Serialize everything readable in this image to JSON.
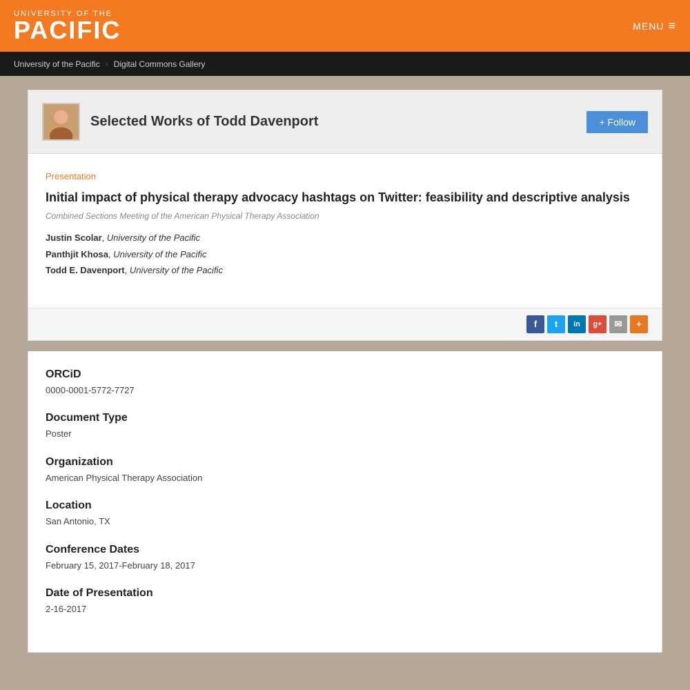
{
  "header": {
    "logo_top": "UNIVERSITY OF THE",
    "logo_bottom": "PACIFIC",
    "menu_label": "MENU"
  },
  "nav": {
    "links": [
      {
        "label": "University of the Pacific"
      },
      {
        "label": "Digital Commons Gallery"
      }
    ]
  },
  "profile": {
    "title": "Selected Works of Todd Davenport",
    "follow_label": "+ Follow"
  },
  "article": {
    "type": "Presentation",
    "title": "Initial impact of physical therapy advocacy hashtags on Twitter: feasibility and descriptive analysis",
    "source": "Combined Sections Meeting of the American Physical Therapy Association",
    "authors": [
      {
        "name": "Justin Scolar",
        "affiliation": "University of the Pacific"
      },
      {
        "name": "Panthjit Khosa",
        "affiliation": "University of the Pacific"
      },
      {
        "name": "Todd E. Davenport",
        "affiliation": "University of the Pacific"
      }
    ]
  },
  "share": {
    "icons": [
      {
        "label": "f",
        "title": "Facebook",
        "class": "share-fb"
      },
      {
        "label": "t",
        "title": "Twitter",
        "class": "share-tw"
      },
      {
        "label": "in",
        "title": "LinkedIn",
        "class": "share-li"
      },
      {
        "label": "g+",
        "title": "Google Plus",
        "class": "share-gp"
      },
      {
        "label": "✉",
        "title": "Email",
        "class": "share-em"
      },
      {
        "label": "+",
        "title": "More",
        "class": "share-more"
      }
    ]
  },
  "metadata": [
    {
      "label": "ORCiD",
      "value": "0000-0001-5772-7727"
    },
    {
      "label": "Document Type",
      "value": "Poster"
    },
    {
      "label": "Organization",
      "value": "American Physical Therapy Association"
    },
    {
      "label": "Location",
      "value": "San Antonio, TX"
    },
    {
      "label": "Conference Dates",
      "value": "February 15, 2017-February 18, 2017"
    },
    {
      "label": "Date of Presentation",
      "value": "2-16-2017"
    }
  ]
}
